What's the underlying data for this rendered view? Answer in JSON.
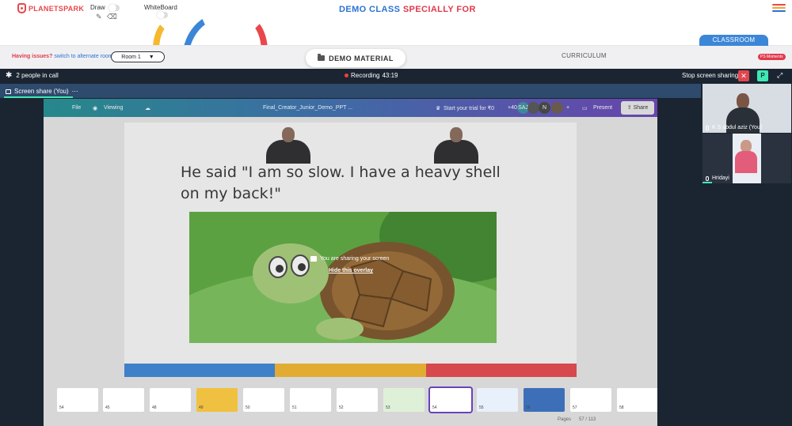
{
  "app": {
    "logo_text": "PLANETSPARK",
    "tools": {
      "draw_label": "Draw",
      "whiteboard_label": "WhiteBoard"
    },
    "demo_title_part1": "DEMO CLASS",
    "demo_title_part2": "SPECIALLY FOR",
    "colors": {
      "brand_red": "#e8474b",
      "brand_blue": "#2b73d3",
      "accent_green": "#3ee9b4",
      "meeting_bg": "#1b2431"
    }
  },
  "toolbar2": {
    "having_issues": "Having issues?",
    "switch_room": "switch to alternate room",
    "room_select": "Room 1",
    "demo_material": "DEMO MATERIAL",
    "curriculum": "CURRICULUM",
    "classroom_tab": "CLASSROOM",
    "ps_moments": "PS Moments"
  },
  "meeting": {
    "people_in_call": "2 people in call",
    "recording_label": "Recording",
    "recording_time": "43:19",
    "stop_sharing": "Stop screen sharing",
    "share_tab_label": "Screen share (You)",
    "avatar_letter": "P"
  },
  "shared_screen": {
    "toolbar": {
      "file": "File",
      "viewing": "Viewing",
      "doc_title": "Final_Creator_Junior_Demo_PPT ...",
      "trial": "Start your trial for ₹0",
      "plus_count": "+40",
      "avatar1": "SAJ",
      "avatar2": "N",
      "present": "Present",
      "share": "Share"
    },
    "slide_text": "He said \"I am so slow. I have a heavy shell on my back!\"",
    "overlay_message": "You are sharing your screen",
    "overlay_hide": "Hide this overlay",
    "thumbnails": [
      "54",
      "45",
      "48",
      "49",
      "50",
      "51",
      "52",
      "53",
      "54",
      "55",
      "56",
      "57",
      "58"
    ],
    "pages_label": "Pages",
    "page_counter": "57 / 113"
  },
  "participants": [
    {
      "name": "K S abdul aziz (You)"
    },
    {
      "name": "Hridayi"
    }
  ]
}
